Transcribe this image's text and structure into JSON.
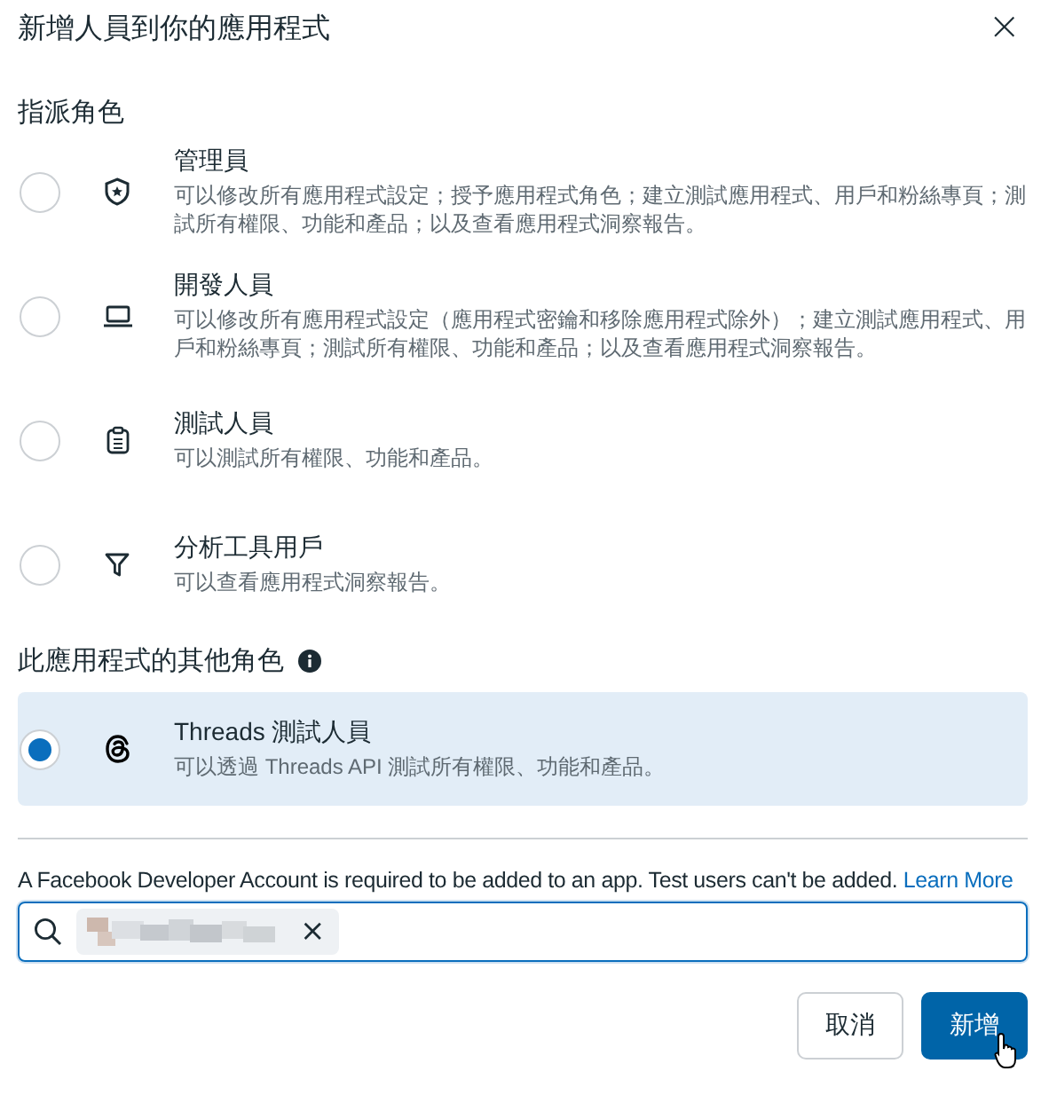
{
  "dialog": {
    "title": "新增人員到你的應用程式",
    "close": "×"
  },
  "assign_roles": {
    "heading": "指派角色",
    "roles": [
      {
        "kind": "shield",
        "name": "管理員",
        "description": "可以修改所有應用程式設定；授予應用程式角色；建立測試應用程式、用戶和粉絲專頁；測試所有權限、功能和產品；以及查看應用程式洞察報告。",
        "selected": false
      },
      {
        "kind": "laptop",
        "name": "開發人員",
        "description": "可以修改所有應用程式設定（應用程式密鑰和移除應用程式除外）；建立測試應用程式、用戶和粉絲專頁；測試所有權限、功能和產品；以及查看應用程式洞察報告。",
        "selected": false
      },
      {
        "kind": "clipboard",
        "name": "測試人員",
        "description": "可以測試所有權限、功能和產品。",
        "selected": false
      },
      {
        "kind": "funnel",
        "name": "分析工具用戶",
        "description": "可以查看應用程式洞察報告。",
        "selected": false
      }
    ]
  },
  "other_roles": {
    "heading": "此應用程式的其他角色",
    "roles": [
      {
        "kind": "threads",
        "name": "Threads 測試人員",
        "description": "可以透過 Threads API 測試所有權限、功能和產品。",
        "selected": true
      }
    ]
  },
  "note": {
    "text": "A Facebook Developer Account is required to be added to an app. Test users can't be added.",
    "link": "Learn More"
  },
  "search": {
    "chip_remove": "×"
  },
  "buttons": [
    {
      "kind": "secondary",
      "label": "取消"
    },
    {
      "kind": "primary",
      "label": "新增"
    }
  ]
}
